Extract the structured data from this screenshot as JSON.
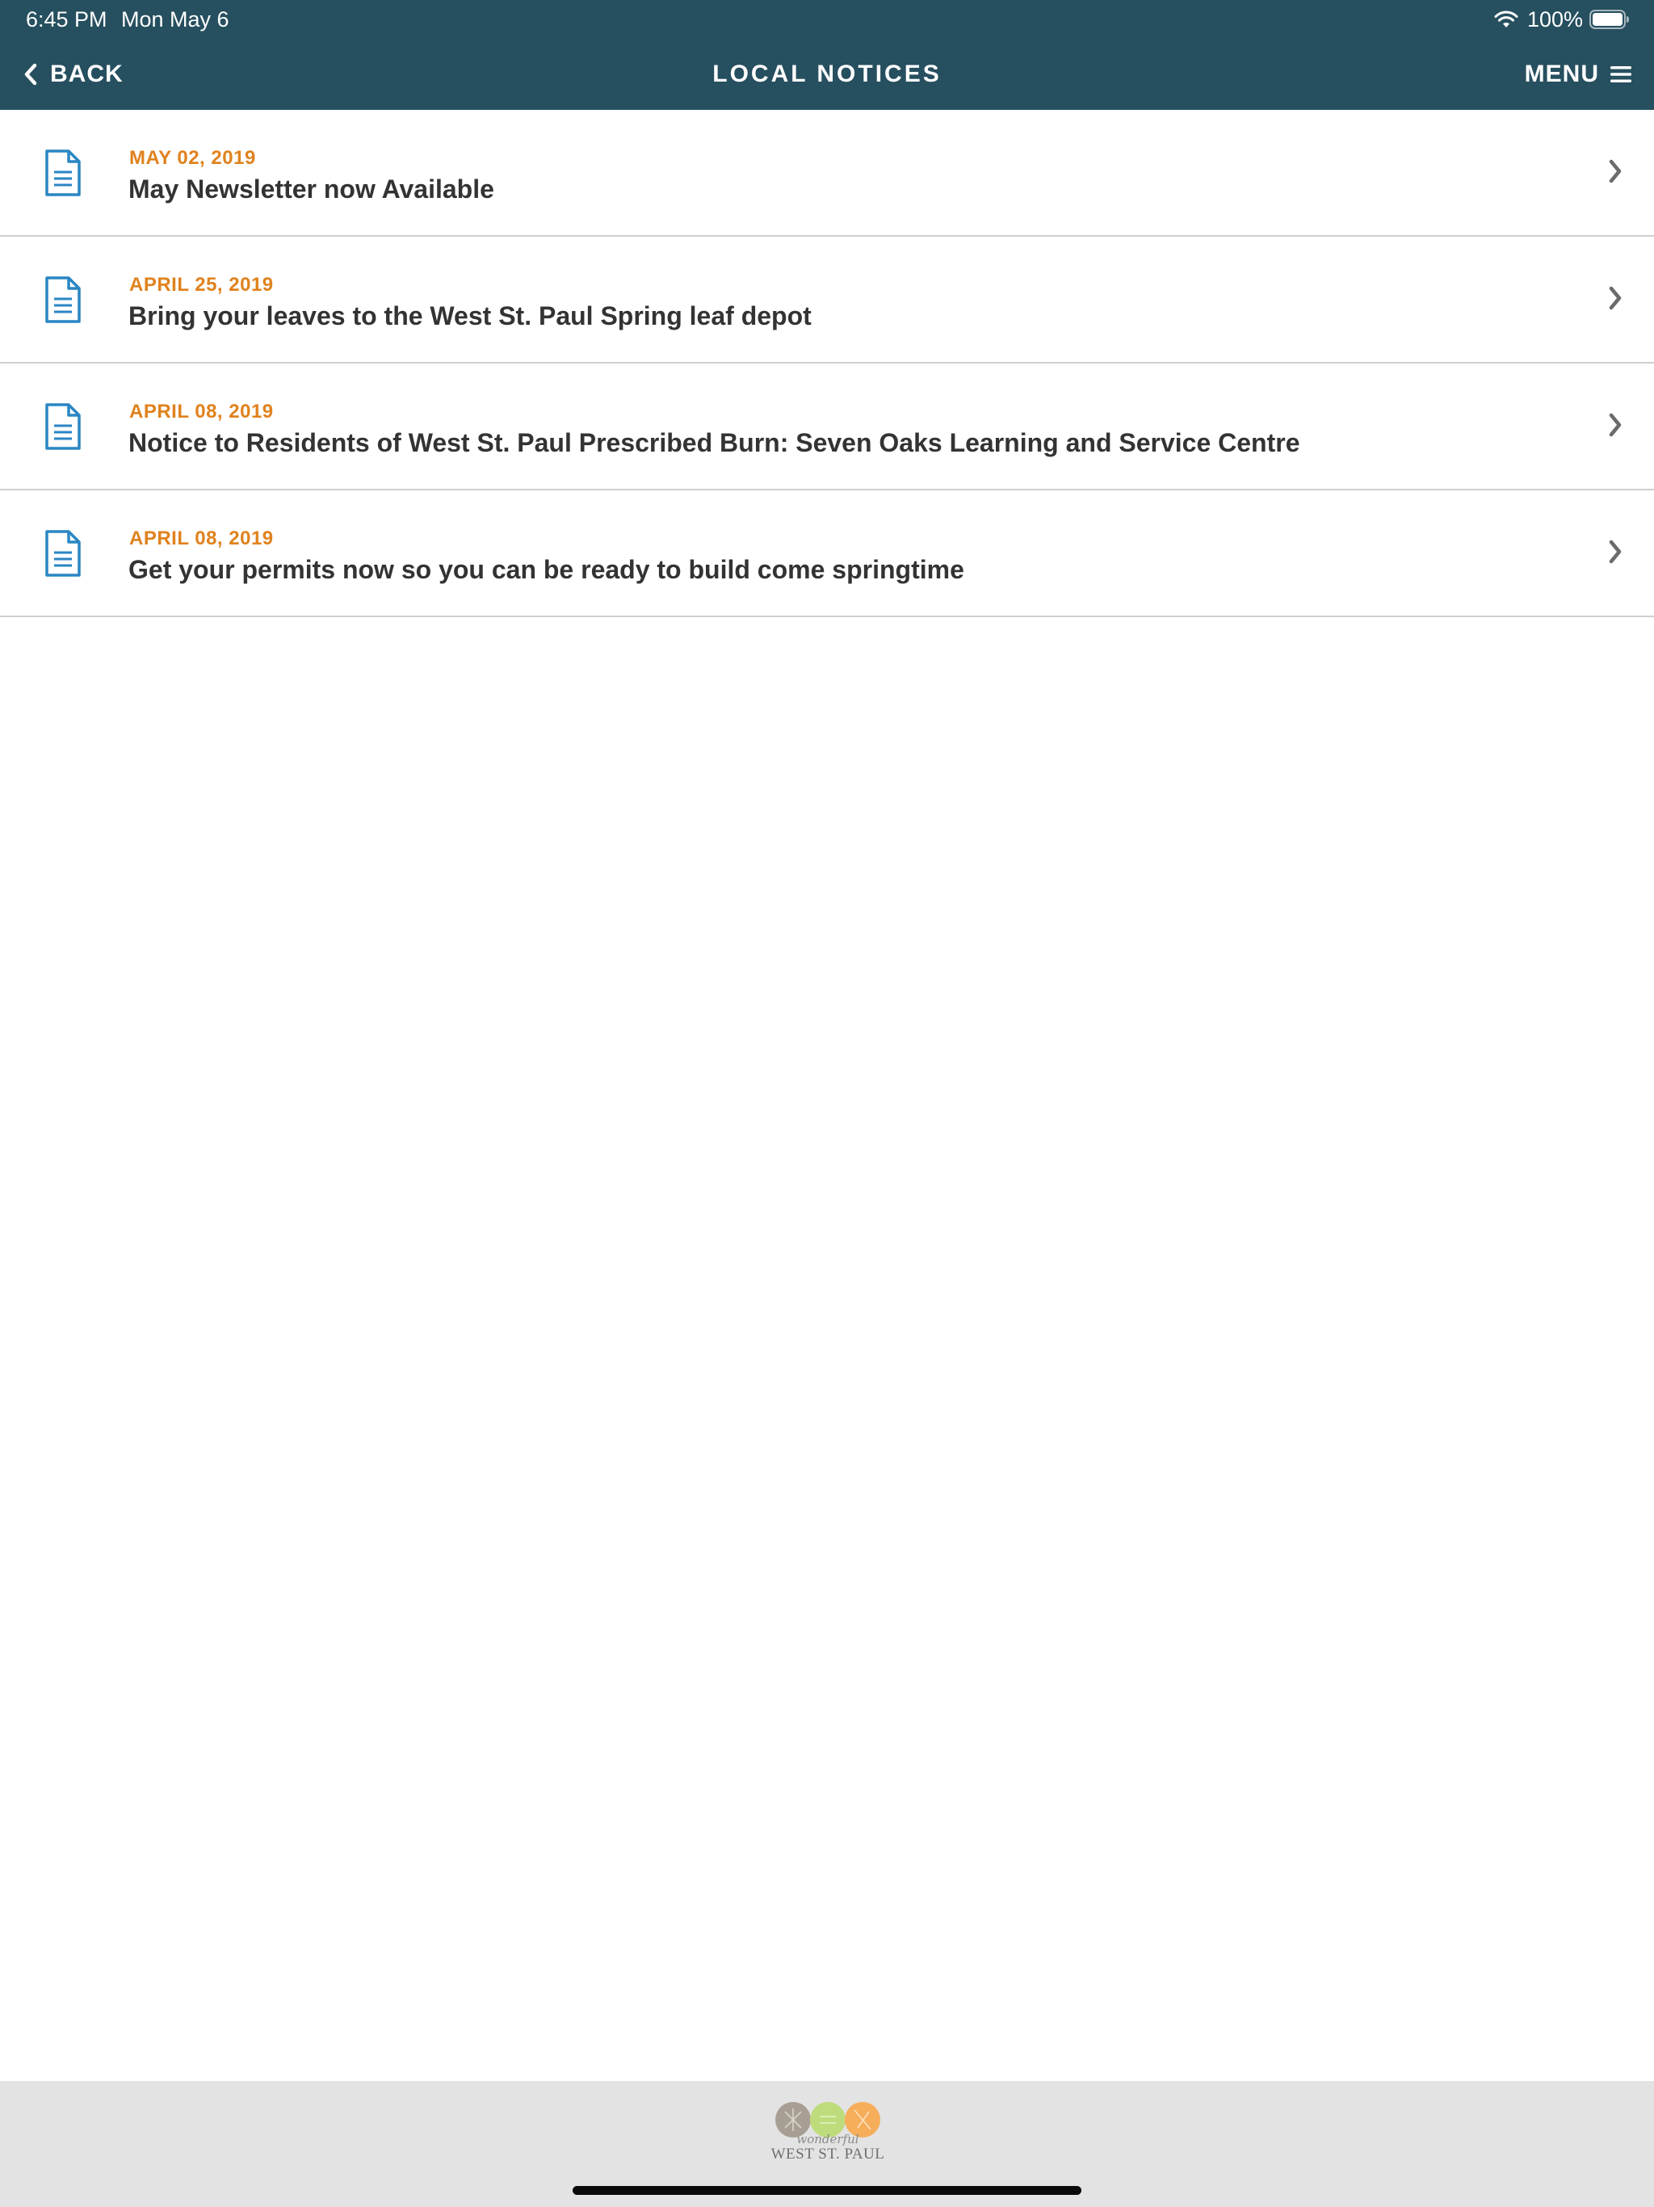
{
  "status_bar": {
    "time": "6:45 PM",
    "date": "Mon May 6",
    "battery": "100%"
  },
  "nav": {
    "back_label": "BACK",
    "title": "LOCAL NOTICES",
    "menu_label": "MENU"
  },
  "notices": [
    {
      "date": "MAY 02, 2019",
      "title": "May Newsletter now Available"
    },
    {
      "date": "APRIL 25, 2019",
      "title": "Bring your leaves to the West St. Paul Spring leaf depot"
    },
    {
      "date": "APRIL 08, 2019",
      "title": "Notice to Residents of West St. Paul Prescribed Burn: Seven Oaks Learning and Service Centre"
    },
    {
      "date": "APRIL 08, 2019",
      "title": "Get your permits now so you can be ready to build come springtime"
    }
  ],
  "footer": {
    "logo_script": "wonderful",
    "logo_name": "WEST ST. PAUL"
  },
  "icons": {
    "back": "chevron-left-icon",
    "menu": "hamburger-menu-icon",
    "notice": "document-icon",
    "row_action": "chevron-right-icon",
    "wifi": "wifi-icon",
    "battery": "battery-icon"
  },
  "colors": {
    "header_bg": "#264f5f",
    "date_accent": "#e0821e",
    "doc_icon": "#2a86c4",
    "title_text": "#333333",
    "footer_bg": "#e3e3e3"
  }
}
